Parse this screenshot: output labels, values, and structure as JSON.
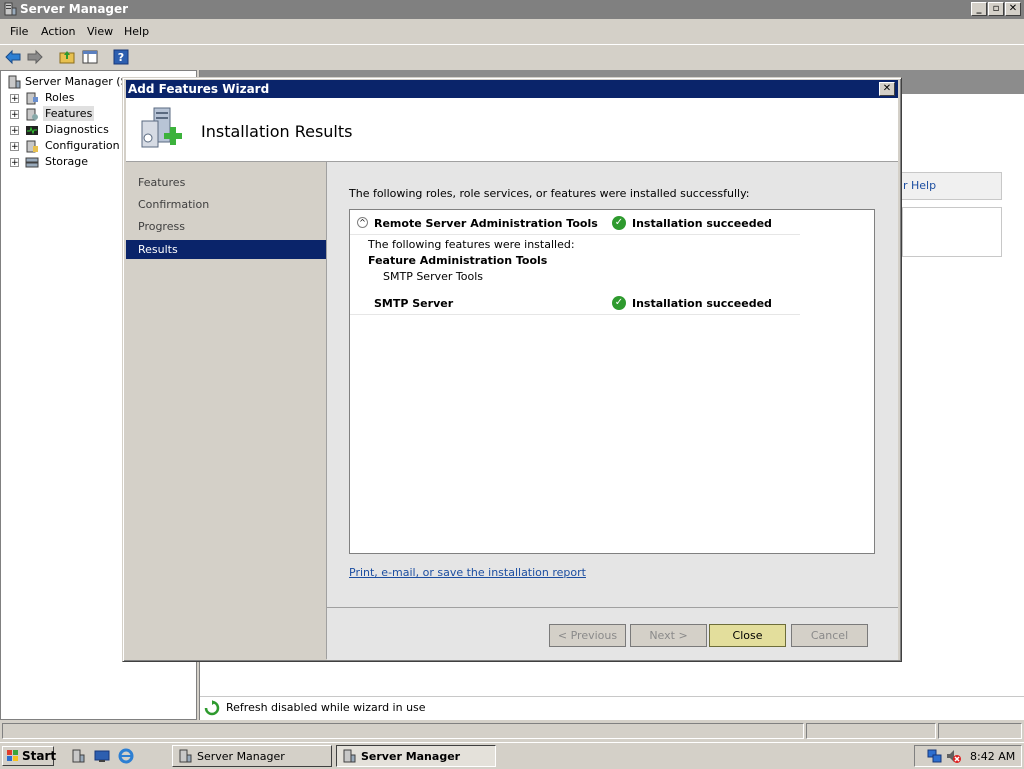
{
  "window": {
    "title": "Server Manager"
  },
  "menu": [
    "File",
    "Action",
    "View",
    "Help"
  ],
  "tree": {
    "root": "Server Manager (SR",
    "items": [
      "Roles",
      "Features",
      "Diagnostics",
      "Configuration",
      "Storage"
    ],
    "selected": "Features"
  },
  "right_pane": {
    "help_link": "r Help",
    "status_text": "Refresh disabled while wizard in use"
  },
  "wizard": {
    "title": "Add Features Wizard",
    "header": "Installation Results",
    "nav": [
      "Features",
      "Confirmation",
      "Progress",
      "Results"
    ],
    "selected_nav": "Results",
    "intro": "The following roles, role services, or features were installed successfully:",
    "results": [
      {
        "name": "Remote Server Administration Tools",
        "status": "Installation succeeded",
        "details_intro": "The following features were installed:",
        "group": "Feature Administration Tools",
        "sub": "SMTP Server Tools"
      },
      {
        "name": "SMTP Server",
        "status": "Installation succeeded"
      }
    ],
    "report_link": "Print, e-mail, or save the installation report",
    "buttons": {
      "previous": "< Previous",
      "next": "Next >",
      "close": "Close",
      "cancel": "Cancel"
    }
  },
  "taskbar": {
    "start": "Start",
    "tasks": [
      "Server Manager",
      "Server Manager"
    ],
    "clock": "8:42 AM"
  },
  "colors": {
    "wizard_title": "#0a246a",
    "selection": "#0a246a",
    "success": "#2e9a2e",
    "link": "#1c4ea1",
    "default_button": "#e3de9c"
  }
}
